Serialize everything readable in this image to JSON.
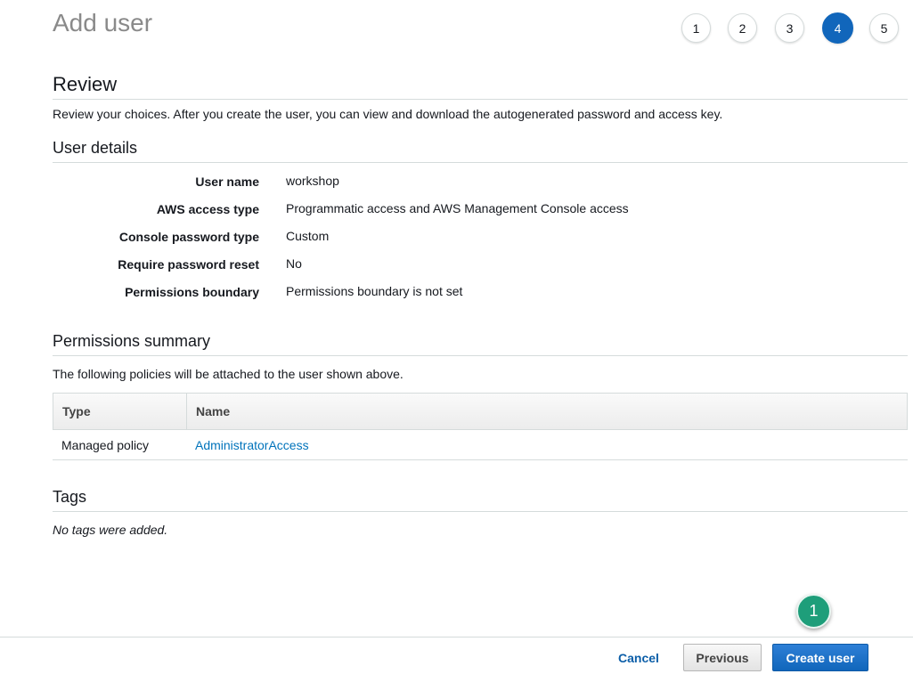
{
  "header": {
    "title": "Add user",
    "steps": [
      "1",
      "2",
      "3",
      "4",
      "5"
    ],
    "active_step": "4"
  },
  "review": {
    "heading": "Review",
    "intro": "Review your choices. After you create the user, you can view and download the autogenerated password and access key."
  },
  "user_details": {
    "heading": "User details",
    "rows": [
      {
        "label": "User name",
        "value": "workshop"
      },
      {
        "label": "AWS access type",
        "value": "Programmatic access and AWS Management Console access"
      },
      {
        "label": "Console password type",
        "value": "Custom"
      },
      {
        "label": "Require password reset",
        "value": "No"
      },
      {
        "label": "Permissions boundary",
        "value": "Permissions boundary is not set"
      }
    ]
  },
  "permissions": {
    "heading": "Permissions summary",
    "intro": "The following policies will be attached to the user shown above.",
    "columns": [
      "Type",
      "Name"
    ],
    "rows": [
      {
        "type": "Managed policy",
        "name": "AdministratorAccess"
      }
    ]
  },
  "tags": {
    "heading": "Tags",
    "empty_text": "No tags were added."
  },
  "footer": {
    "cancel_label": "Cancel",
    "previous_label": "Previous",
    "create_label": "Create user",
    "callout_number": "1"
  },
  "colors": {
    "primary": "#1166bb",
    "link": "#0073bb",
    "callout": "#1e9e7a"
  }
}
